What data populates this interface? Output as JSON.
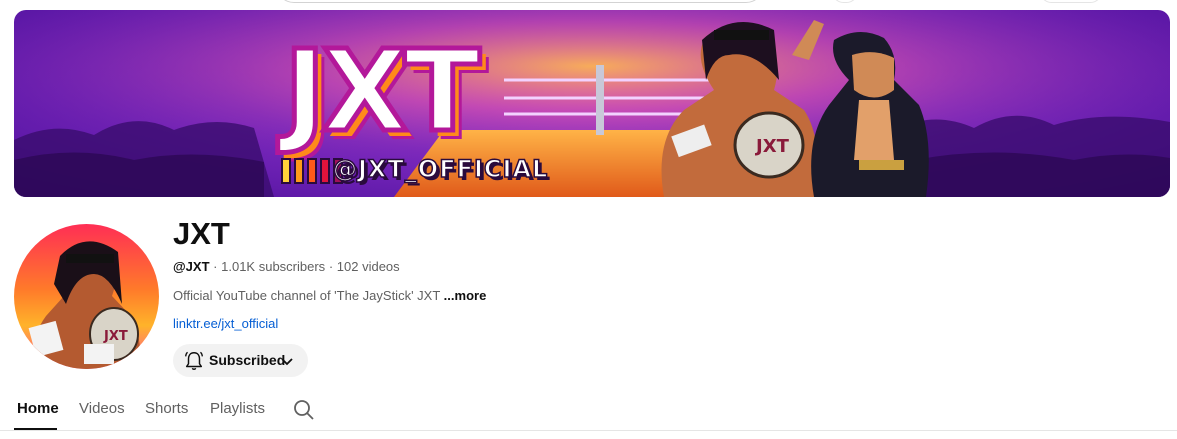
{
  "banner": {
    "logo_text": "JXT",
    "handle_text": "@JXT_OFFICIAL"
  },
  "channel": {
    "name": "JXT",
    "handle": "@JXT",
    "subscribers": "1.01K subscribers",
    "videos": "102 videos",
    "separator": "·",
    "description": "Official YouTube channel of 'The JayStick' JXT",
    "more_label": "...more",
    "link": "linktr.ee/jxt_official"
  },
  "subscribe": {
    "label": "Subscribed",
    "bell_icon": "bell-icon",
    "chevron_icon": "chevron-down-icon"
  },
  "tabs": [
    {
      "label": "Home",
      "active": true
    },
    {
      "label": "Videos",
      "active": false
    },
    {
      "label": "Shorts",
      "active": false
    },
    {
      "label": "Playlists",
      "active": false
    }
  ],
  "colors": {
    "banner_purple": "#7d2ac0",
    "link_blue": "#065fd4",
    "button_bg": "#f2f2f2"
  }
}
